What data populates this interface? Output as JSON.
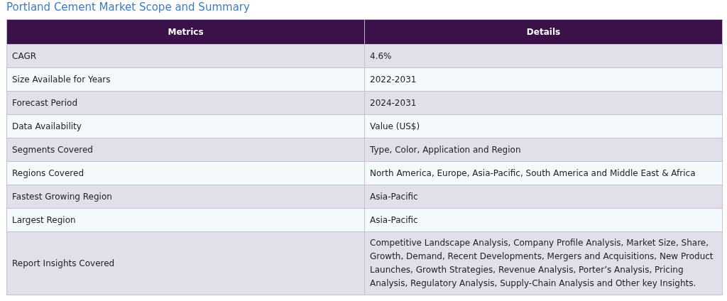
{
  "title": "Portland Cement Market Scope and Summary",
  "table": {
    "columns": [
      "Metrics",
      "Details"
    ],
    "rows": [
      {
        "metric": "CAGR",
        "details": "4.6%"
      },
      {
        "metric": "Size Available for Years",
        "details": "2022-2031"
      },
      {
        "metric": "Forecast Period",
        "details": "2024-2031"
      },
      {
        "metric": "Data Availability",
        "details": "Value (US$)"
      },
      {
        "metric": "Segments Covered",
        "details": "Type, Color, Application and Region"
      },
      {
        "metric": "Regions Covered",
        "details": "North America, Europe, Asia-Pacific, South America and Middle East & Africa"
      },
      {
        "metric": "Fastest Growing Region",
        "details": "Asia-Pacific"
      },
      {
        "metric": "Largest Region",
        "details": "Asia-Pacific"
      },
      {
        "metric": "Report Insights Covered",
        "details": "Competitive Landscape Analysis, Company Profile Analysis, Market Size, Share, Growth, Demand, Recent Developments, Mergers and Acquisitions, New Product Launches, Growth Strategies, Revenue Analysis, Porter’s Analysis, Pricing Analysis, Regulatory Analysis, Supply-Chain Analysis and Other key Insights."
      }
    ]
  }
}
